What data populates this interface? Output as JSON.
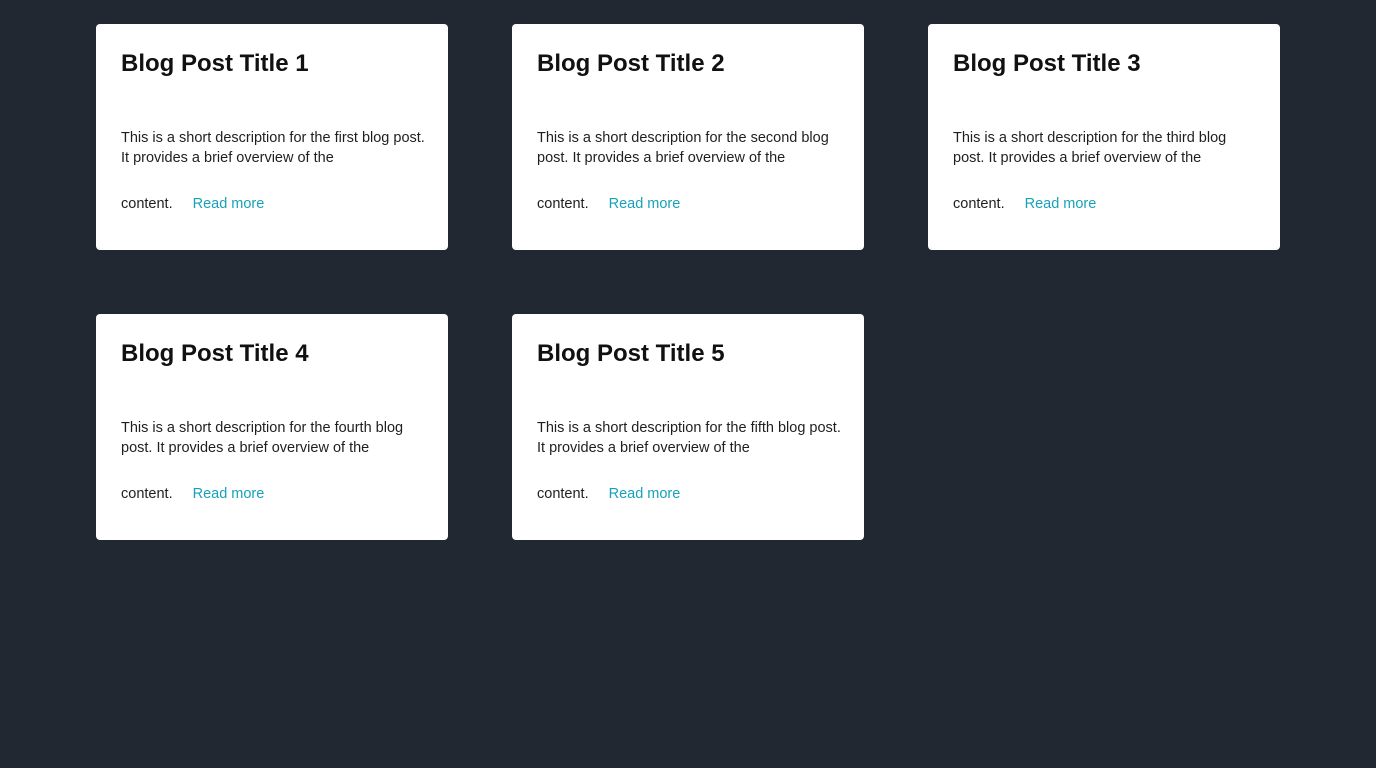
{
  "theme": {
    "background": "#222831",
    "card_background": "#ffffff",
    "link_color": "#17a2b8"
  },
  "posts": [
    {
      "title": "Blog Post Title 1",
      "description": "This is a short description for the first blog post. It provides a brief overview of the",
      "description_tail": "content.",
      "link_label": "Read more"
    },
    {
      "title": "Blog Post Title 2",
      "description": "This is a short description for the second blog post. It provides a brief overview of the",
      "description_tail": "content.",
      "link_label": "Read more"
    },
    {
      "title": "Blog Post Title 3",
      "description": "This is a short description for the third blog post. It provides a brief overview of the",
      "description_tail": "content.",
      "link_label": "Read more"
    },
    {
      "title": "Blog Post Title 4",
      "description": "This is a short description for the fourth blog post. It provides a brief overview of the",
      "description_tail": "content.",
      "link_label": "Read more"
    },
    {
      "title": "Blog Post Title 5",
      "description": "This is a short description for the fifth blog post. It provides a brief overview of the",
      "description_tail": "content.",
      "link_label": "Read more"
    }
  ]
}
